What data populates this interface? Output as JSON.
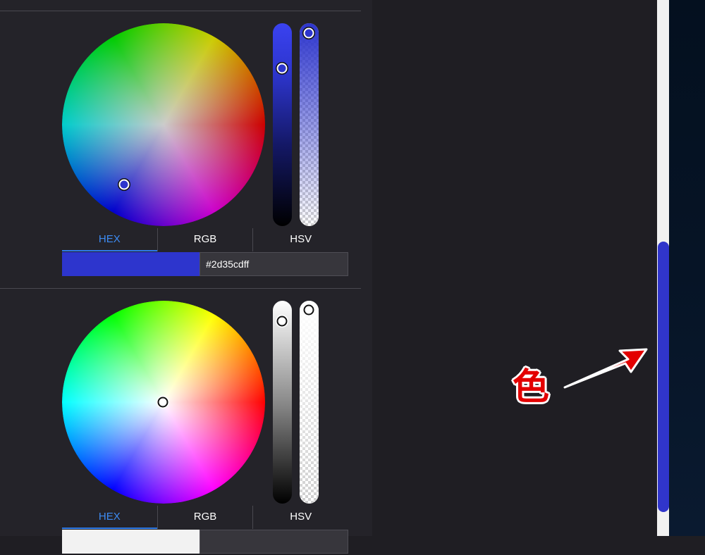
{
  "picker_top": {
    "tabs": [
      {
        "label": "HEX",
        "active": true
      },
      {
        "label": "RGB",
        "active": false
      },
      {
        "label": "HSV",
        "active": false
      }
    ],
    "hex_value": "#2d35cdff",
    "swatch_color": "#2d35cd",
    "brightness_level": 0.8,
    "alpha_level": 1.0
  },
  "picker_bottom": {
    "tabs": [
      {
        "label": "HEX",
        "active": true
      },
      {
        "label": "RGB",
        "active": false
      },
      {
        "label": "HSV",
        "active": false
      }
    ],
    "brightness_level": 1.0,
    "alpha_level": 1.0
  },
  "annotation": {
    "text": "色",
    "color": "#e30000"
  },
  "scrollbar": {
    "thumb_color": "#3035cb"
  }
}
